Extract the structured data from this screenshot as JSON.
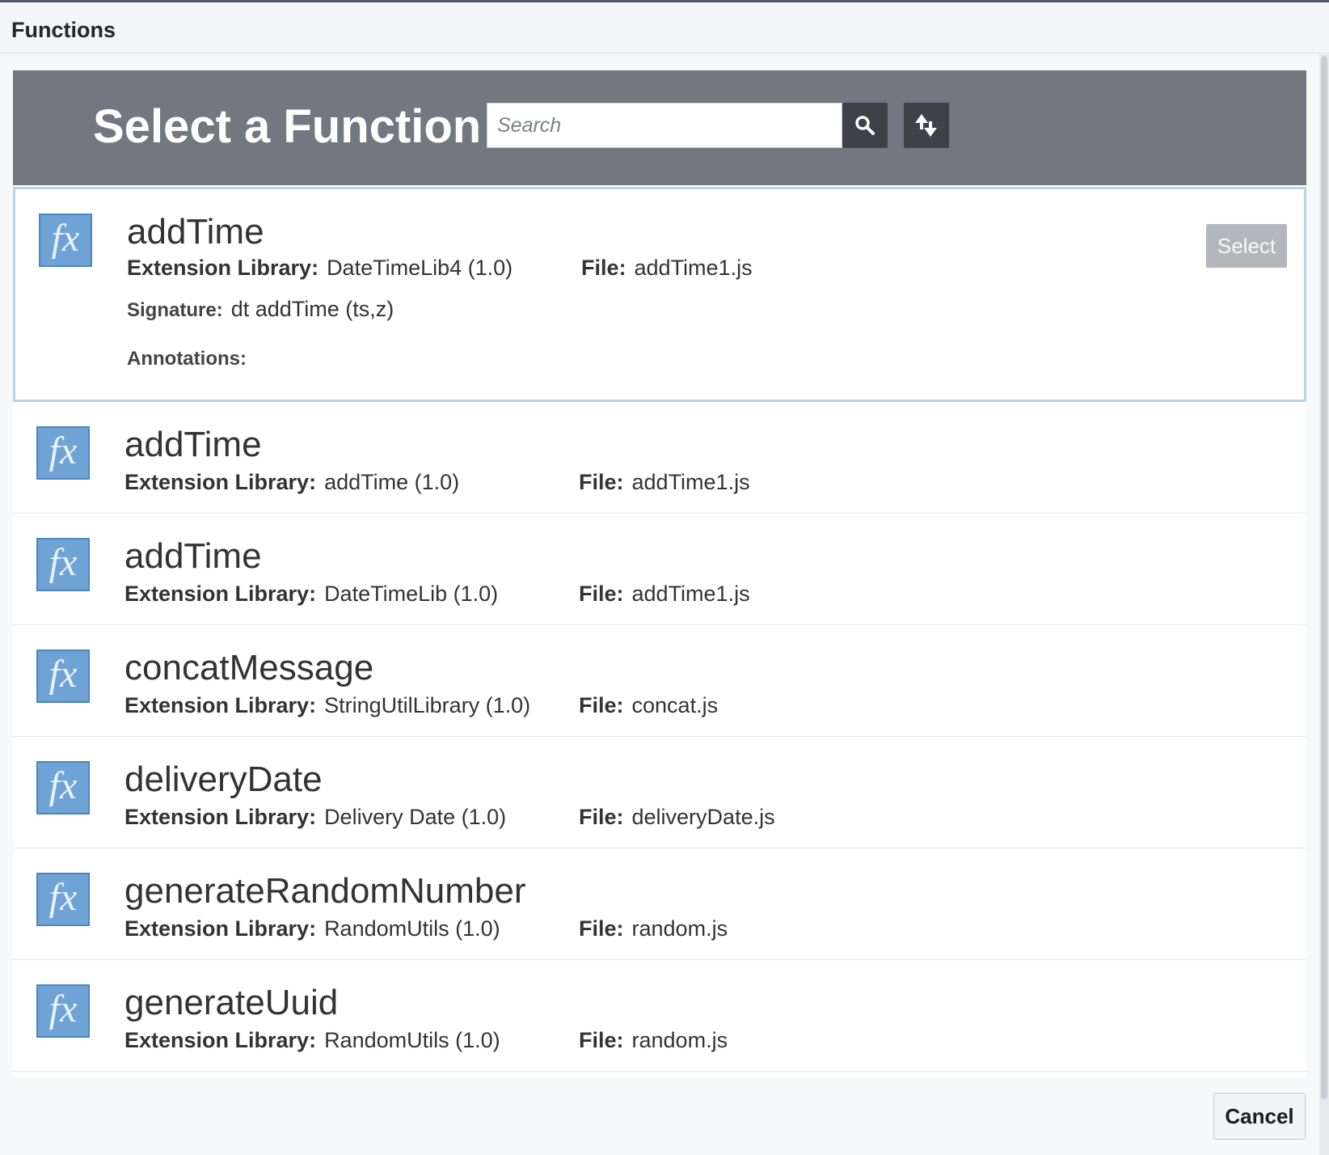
{
  "window": {
    "title": "Functions"
  },
  "header": {
    "title": "Select a Function",
    "search_placeholder": "Search",
    "search_button_icon": "search-icon",
    "sort_button_icon": "sort-icon"
  },
  "labels": {
    "extension_library": "Extension Library:",
    "file": "File:",
    "signature": "Signature:",
    "annotations": "Annotations:"
  },
  "functions": [
    {
      "name": "addTime",
      "library": "DateTimeLib4 (1.0)",
      "file": "addTime1.js",
      "signature": "dt addTime (ts,z)",
      "select_label": "Select"
    },
    {
      "name": "addTime",
      "library": "addTime (1.0)",
      "file": "addTime1.js"
    },
    {
      "name": "addTime",
      "library": "DateTimeLib (1.0)",
      "file": "addTime1.js"
    },
    {
      "name": "concatMessage",
      "library": "StringUtilLibrary (1.0)",
      "file": "concat.js"
    },
    {
      "name": "deliveryDate",
      "library": "Delivery Date (1.0)",
      "file": "deliveryDate.js"
    },
    {
      "name": "generateRandomNumber",
      "library": "RandomUtils (1.0)",
      "file": "random.js"
    },
    {
      "name": "generateUuid",
      "library": "RandomUtils (1.0)",
      "file": "random.js"
    }
  ],
  "icon": {
    "text": "fx",
    "name": "function-icon"
  },
  "footer": {
    "cancel_label": "Cancel"
  },
  "colors": {
    "header_bg": "#737780",
    "icon_button_bg": "#3d4148",
    "fx_icon_bg": "#6fa3d6",
    "selected_border": "#b7d4ec",
    "select_button_bg": "#b3b6ba"
  }
}
